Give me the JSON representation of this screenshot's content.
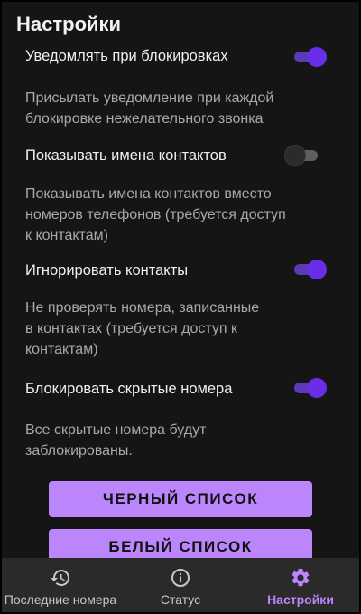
{
  "header": {
    "title": "Настройки"
  },
  "settings": [
    {
      "label": "Уведомлять при блокировках",
      "toggle": "on"
    },
    {
      "desc": [
        "Присылать уведомление при каждой",
        "блокировке нежелательного звонка"
      ]
    },
    {
      "label": "Показывать имена контактов",
      "toggle": "off"
    },
    {
      "desc": [
        "Показывать имена контактов вместо",
        "номеров телефонов (требуется доступ",
        "к контактам)"
      ]
    },
    {
      "label": "Игнорировать контакты",
      "toggle": "on"
    },
    {
      "desc": [
        "Не проверять номера, записанные",
        "в контактах (требуется доступ к",
        "контактам)"
      ]
    },
    {
      "label": "Блокировать скрытые номера",
      "toggle": "on"
    },
    {
      "desc": [
        "Все скрытые номера будут",
        "заблокированы."
      ]
    }
  ],
  "buttons": {
    "blacklist": "Черный список",
    "whitelist": "Белый список"
  },
  "nav": {
    "recent": "Последние номера",
    "status": "Статус",
    "settings": "Настройки"
  },
  "colors": {
    "accent": "#bb86fc",
    "toggle_on": "#6a2ee8",
    "background": "#151515"
  }
}
